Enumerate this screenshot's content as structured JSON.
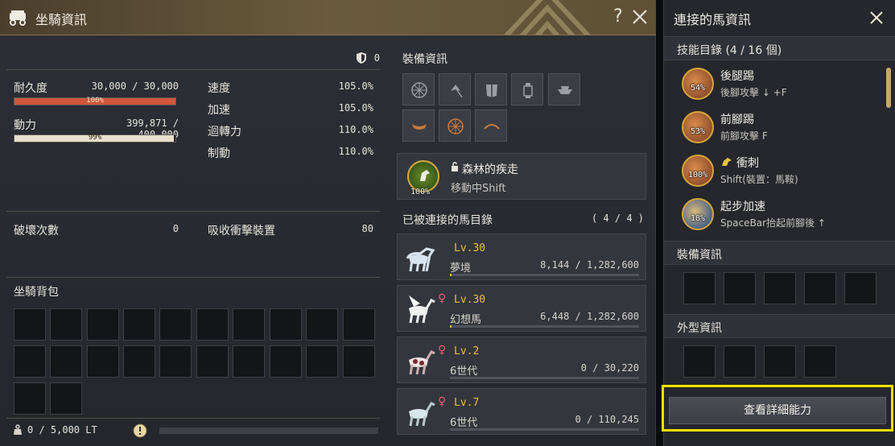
{
  "window": {
    "title": "坐騎資訊",
    "help": "?"
  },
  "stats": {
    "shield_value": "0",
    "durability": {
      "label": "耐久度",
      "value": "30,000 / 30,000",
      "pct_text": "100%",
      "fill": 1.0
    },
    "stamina": {
      "label": "動力",
      "value": "399,871 / 400,000",
      "pct_text": "99%",
      "fill": 0.99
    },
    "attrs": [
      {
        "label": "速度",
        "value": "105.0%"
      },
      {
        "label": "加速",
        "value": "105.0%"
      },
      {
        "label": "迴轉力",
        "value": "110.0%"
      },
      {
        "label": "制動",
        "value": "110.0%"
      }
    ],
    "break_label": "破壞次數",
    "break_value": "0",
    "absorb_label": "吸收衝擊裝置",
    "absorb_value": "80"
  },
  "inventory": {
    "title": "坐騎背包",
    "weight": "0 / 5,000 LT"
  },
  "equipment": {
    "title": "裝備資訊"
  },
  "skill_card": {
    "name": "森林的疾走",
    "sub": "移動中Shift",
    "pct": "100%"
  },
  "horses": {
    "title": "已被連接的馬目錄",
    "count": "( 4 / 4 )",
    "list": [
      {
        "lv": "Lv.30",
        "name": "夢境",
        "xp": "8,144 / 1,282,600",
        "gender": "",
        "progress": 0.006
      },
      {
        "lv": "Lv.30",
        "name": "幻想馬",
        "xp": "6,448 / 1,282,600",
        "gender": "♀",
        "progress": 0.005
      },
      {
        "lv": "Lv.2",
        "name": "6世代",
        "xp": "0 / 30,220",
        "gender": "♀",
        "progress": 0
      },
      {
        "lv": "Lv.7",
        "name": "6世代",
        "xp": "0 / 110,245",
        "gender": "♀",
        "progress": 0
      }
    ]
  },
  "right_panel": {
    "title": "連接的馬資訊",
    "skills_title": "技能目錄 (4 / 16 個)",
    "skills": [
      {
        "name": "後腿踢",
        "key": "後腳攻擊 ↓ +F",
        "pct": "54%"
      },
      {
        "name": "前腳踢",
        "key": "前腳攻擊 F",
        "pct": "53%"
      },
      {
        "name": "衝刺",
        "key": "Shift(裝置：馬鞍)",
        "pct": "100%"
      },
      {
        "name": "起步加速",
        "key": "SpaceBar抬起前腳後 ↑",
        "pct": "18%"
      }
    ],
    "equip_title": "裝備資訊",
    "appearance_title": "外型資訊",
    "detail_button": "查看詳細能力"
  }
}
